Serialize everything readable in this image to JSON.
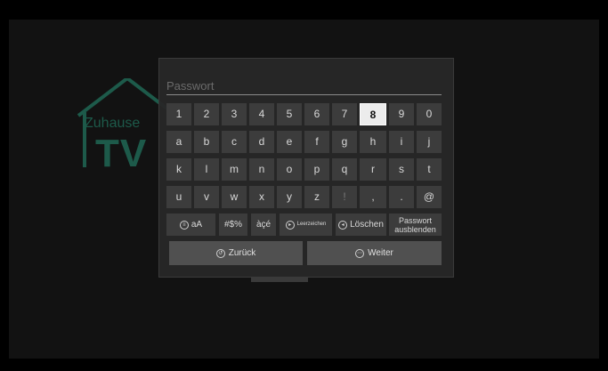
{
  "brand": {
    "line1": "Zuhause",
    "line2": "TV"
  },
  "input": {
    "placeholder": "Passwort"
  },
  "keyboard": {
    "row_digits": [
      "1",
      "2",
      "3",
      "4",
      "5",
      "6",
      "7",
      "8",
      "9",
      "0"
    ],
    "row_2": [
      "a",
      "b",
      "c",
      "d",
      "e",
      "f",
      "g",
      "h",
      "i",
      "j"
    ],
    "row_3": [
      "k",
      "l",
      "m",
      "n",
      "o",
      "p",
      "q",
      "r",
      "s",
      "t"
    ],
    "row_4": [
      "u",
      "v",
      "w",
      "x",
      "y",
      "z",
      "!",
      ",",
      ".",
      "@"
    ],
    "selected": "8",
    "controls": {
      "case_toggle": "aA",
      "symbols": "#$%",
      "accents": "àçé",
      "space": "Leerzeichen",
      "delete": "Löschen",
      "hide_password_line1": "Passwort",
      "hide_password_line2": "ausblenden"
    }
  },
  "buttons": {
    "back": "Zurück",
    "next": "Weiter"
  },
  "icons": [
    "house-icon",
    "case-toggle-icon",
    "space-icon",
    "delete-icon",
    "back-icon",
    "next-icon"
  ]
}
